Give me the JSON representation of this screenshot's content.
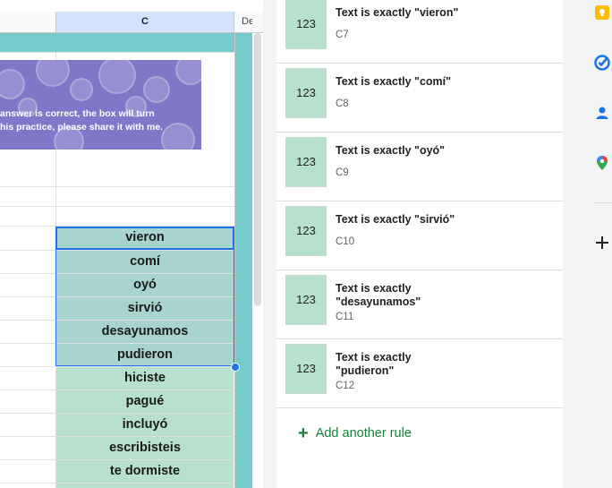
{
  "spreadsheet": {
    "column_c_header": "C",
    "column_d_header": "De",
    "banner_lines": [
      "answer is correct, the box will turn",
      "his practice, please share it with me."
    ],
    "cells": [
      {
        "text": "vieron",
        "state": "selected"
      },
      {
        "text": "comí",
        "state": "selected"
      },
      {
        "text": "oyó",
        "state": "selected"
      },
      {
        "text": "sirvió",
        "state": "selected"
      },
      {
        "text": "desayunamos",
        "state": "selected"
      },
      {
        "text": "pudieron",
        "state": "selected"
      },
      {
        "text": "hiciste",
        "state": "green"
      },
      {
        "text": "pagué",
        "state": "green"
      },
      {
        "text": "incluyó",
        "state": "green"
      },
      {
        "text": "escribisteis",
        "state": "green"
      },
      {
        "text": "te dormiste",
        "state": "green"
      }
    ]
  },
  "panel": {
    "rules": [
      {
        "preview": "123",
        "title": "Text is exactly \"vieron\"",
        "range": "C7"
      },
      {
        "preview": "123",
        "title": "Text is exactly \"comí\"",
        "range": "C8"
      },
      {
        "preview": "123",
        "title": "Text is exactly \"oyó\"",
        "range": "C9"
      },
      {
        "preview": "123",
        "title": "Text is exactly \"sirvió\"",
        "range": "C10"
      },
      {
        "preview": "123",
        "title": "Text is exactly \"desayunamos\"",
        "range": "C11"
      },
      {
        "preview": "123",
        "title": "Text is exactly \"pudieron\"",
        "range": "C12"
      }
    ],
    "add_rule_icon": "plus-icon",
    "add_rule_label": "Add another rule"
  },
  "sidebar": {
    "icons": [
      "keep-icon",
      "tasks-icon",
      "contacts-icon",
      "maps-icon",
      "plus-icon"
    ]
  },
  "colors": {
    "rule_fill": "#b7e1cd",
    "selection": "#1a73e8",
    "header_teal": "#76cccc",
    "accent_green": "#188038"
  }
}
